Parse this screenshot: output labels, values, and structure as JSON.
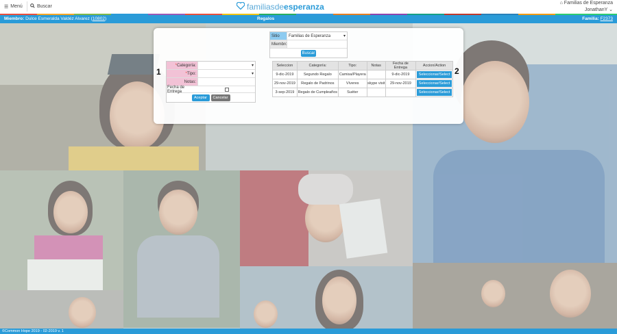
{
  "header": {
    "menu_label": "Menú",
    "search_label": "Buscar",
    "logo_light": "familias",
    "logo_mid": "de",
    "logo_bold": "esperanza",
    "org_name": "Familias de Esperanza",
    "user_name": "JonathanY"
  },
  "member_bar": {
    "member_label": "Miembro:",
    "member_name": "Dulce Esmeralda Valdéz Alvarez",
    "member_id": "10802",
    "page_title": "Regalos",
    "family_label": "Familia:",
    "family_id": "F2373"
  },
  "site_search": {
    "site_label": "Sitio",
    "site_value": "Familias de Esperanza",
    "member_label": "Miembro",
    "member_value": "",
    "search_button": "Buscar"
  },
  "gift_form": {
    "callout": "1",
    "category_label": "Categoría:",
    "type_label": "Tipo:",
    "notes_label": "Notas:",
    "delivery_date_label": "Fecha de Entrega",
    "accept_button": "Aceptar",
    "cancel_button": "Cancelar"
  },
  "gifts_table": {
    "callout": "2",
    "headers": [
      "Seleccion",
      "Categoría:",
      "Tipo:",
      "Notas",
      "Fecha de Entrega",
      "Accion/Action"
    ],
    "rows": [
      {
        "seleccion": "9-dic-2019",
        "categoria": "Segundo Regalo",
        "tipo": "Camisa/Playera",
        "notas": "",
        "fecha": "9-dic-2019",
        "accion": "Seleccionar/Select"
      },
      {
        "seleccion": "29-nov-2019",
        "categoria": "Regalo de Padrinos",
        "tipo": "Víveres",
        "notas": "skype visit",
        "fecha": "29-nov-2019",
        "accion": "Seleccionar/Select"
      },
      {
        "seleccion": "3-sep-2019",
        "categoria": "Regalo de Cumpleaños",
        "tipo": "Suéter",
        "notas": "",
        "fecha": "",
        "accion": "Seleccionar/Select"
      }
    ]
  },
  "footer": {
    "text": "©Common Hope 2019 - 02-2019 v. 1"
  },
  "colors": {
    "brand_blue": "#2a9bd8",
    "required_field_pink": "#f2c2d6",
    "cancel_grey": "#777777"
  }
}
